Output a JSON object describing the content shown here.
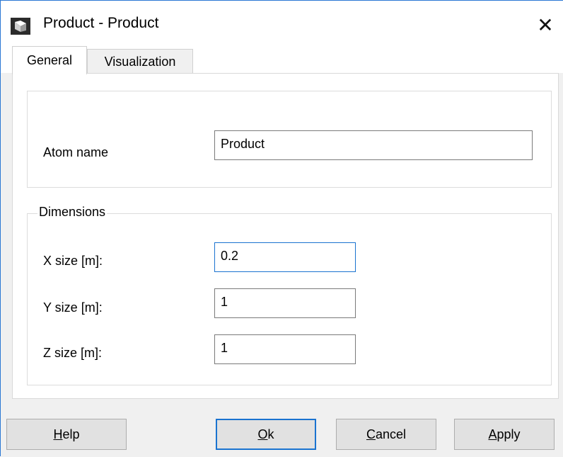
{
  "window": {
    "title": "Product - Product"
  },
  "tabs": [
    {
      "label": "General",
      "active": true
    },
    {
      "label": "Visualization",
      "active": false
    }
  ],
  "atom": {
    "label": "Atom name",
    "value": "Product"
  },
  "dimensions": {
    "legend": "Dimensions",
    "fields": [
      {
        "label": "X size [m]:",
        "value": "0.2"
      },
      {
        "label": "Y size [m]:",
        "value": "1"
      },
      {
        "label": "Z size [m]:",
        "value": "1"
      }
    ]
  },
  "buttons": {
    "help": {
      "mnemonic": "H",
      "rest": "elp"
    },
    "ok": {
      "mnemonic": "O",
      "rest": "k"
    },
    "cancel": {
      "mnemonic": "C",
      "rest": "ancel"
    },
    "apply": {
      "mnemonic": "A",
      "rest": "pply"
    }
  },
  "colors": {
    "focus": "#1a73d0",
    "window_border": "#2b78d4"
  },
  "icons": {
    "app": "cube-icon",
    "close": "close-icon"
  }
}
